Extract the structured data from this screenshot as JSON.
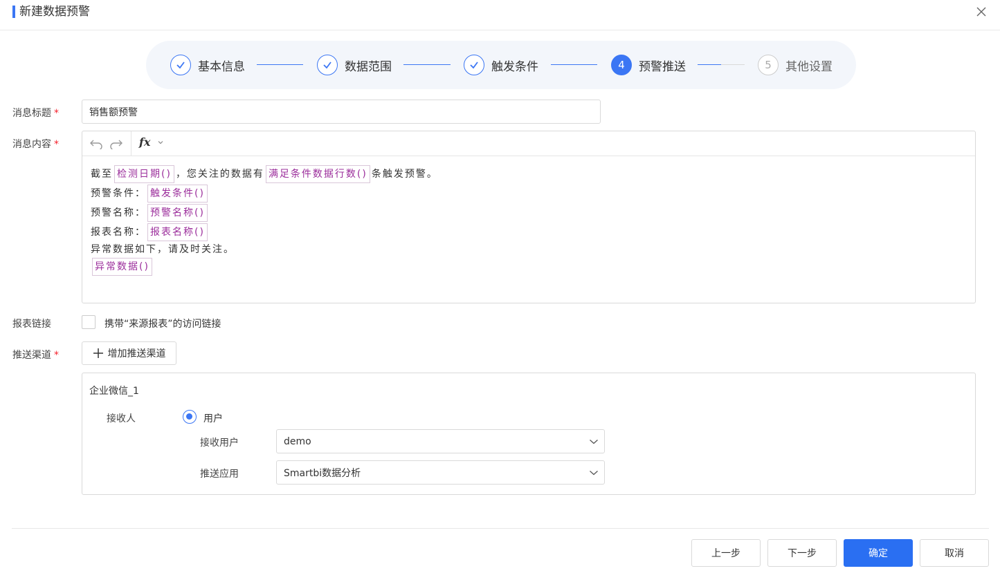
{
  "header": {
    "title": "新建数据预警"
  },
  "steps": [
    {
      "index": "✓",
      "label": "基本信息",
      "state": "done"
    },
    {
      "index": "✓",
      "label": "数据范围",
      "state": "done"
    },
    {
      "index": "✓",
      "label": "触发条件",
      "state": "done"
    },
    {
      "index": "4",
      "label": "预警推送",
      "state": "active"
    },
    {
      "index": "5",
      "label": "其他设置",
      "state": "todo"
    }
  ],
  "form": {
    "msg_title_label": "消息标题",
    "msg_title_value": "销售额预警",
    "msg_content_label": "消息内容",
    "required_mark": "*",
    "editor": {
      "fx_label": "fx",
      "line1_a": "截至",
      "line1_tag1": "检测日期()",
      "line1_b": "，您关注的数据有",
      "line1_tag2": "满足条件数据行数()",
      "line1_c": "条触发预警。",
      "line2_a": "预警条件：",
      "line2_tag": "触发条件()",
      "line3_a": "预警名称：",
      "line3_tag": "预警名称()",
      "line4_a": "报表名称：",
      "line4_tag": "报表名称()",
      "line5": "异常数据如下，请及时关注。",
      "line6_tag": "异常数据()"
    },
    "report_link_label": "报表链接",
    "report_link_checkbox_text": "携带“来源报表”的访问链接",
    "report_link_checked": false,
    "channel_label": "推送渠道",
    "add_channel_button": "增加推送渠道",
    "channel": {
      "title": "企业微信_1",
      "receiver_label": "接收人",
      "receiver_option": "用户",
      "receiver_selected": true,
      "recv_user_label": "接收用户",
      "recv_user_value": "demo",
      "push_app_label": "推送应用",
      "push_app_value": "Smartbi数据分析"
    }
  },
  "footer": {
    "prev": "上一步",
    "next": "下一步",
    "ok": "确定",
    "cancel": "取消"
  },
  "colors": {
    "accent": "#3b76f4",
    "tag_text": "#9b2d9b",
    "required": "#f5222d"
  }
}
